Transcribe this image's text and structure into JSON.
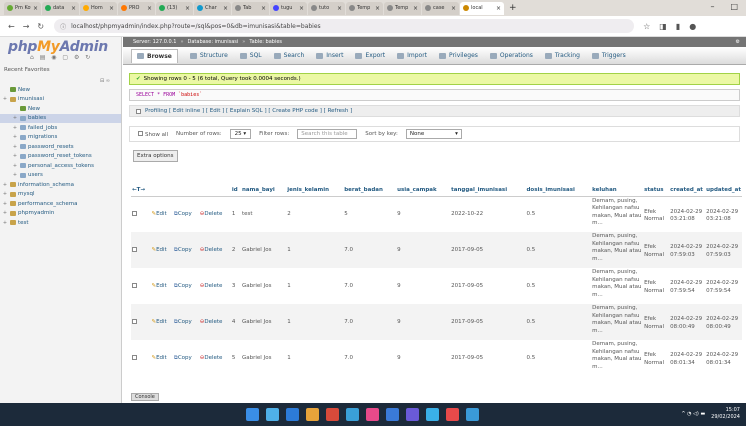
{
  "browser": {
    "tabs": [
      {
        "label": "Pm Kotak",
        "color": "#6a3"
      },
      {
        "label": "data",
        "color": "#2a5"
      },
      {
        "label": "Hom",
        "color": "#fa0"
      },
      {
        "label": "PRO",
        "color": "#f70"
      },
      {
        "label": "(13)",
        "color": "#2a5"
      },
      {
        "label": "Char",
        "color": "#19c"
      },
      {
        "label": "Tab",
        "color": "#888"
      },
      {
        "label": "tugu",
        "color": "#44f"
      },
      {
        "label": "tuto",
        "color": "#888"
      },
      {
        "label": "Temp",
        "color": "#888"
      },
      {
        "label": "Temp",
        "color": "#888"
      },
      {
        "label": "case",
        "color": "#888"
      },
      {
        "label": "local",
        "color": "#c80",
        "active": true
      }
    ],
    "url": "localhost/phpmyadmin/index.php?route=/sql&pos=0&db=imunisasi&table=babies"
  },
  "sidebar": {
    "logo_php": "php",
    "logo_my": "My",
    "logo_admin": "Admin",
    "recent": "Recent   Favorites",
    "tree": [
      {
        "label": "New",
        "level": 0,
        "type": "new"
      },
      {
        "label": "imunisasi",
        "level": 0,
        "type": "db"
      },
      {
        "label": "New",
        "level": 1,
        "type": "new"
      },
      {
        "label": "babies",
        "level": 1,
        "type": "tbl",
        "selected": true
      },
      {
        "label": "failed_jobs",
        "level": 1,
        "type": "tbl"
      },
      {
        "label": "migrations",
        "level": 1,
        "type": "tbl"
      },
      {
        "label": "password_resets",
        "level": 1,
        "type": "tbl"
      },
      {
        "label": "password_reset_tokens",
        "level": 1,
        "type": "tbl"
      },
      {
        "label": "personal_access_tokens",
        "level": 1,
        "type": "tbl"
      },
      {
        "label": "users",
        "level": 1,
        "type": "tbl"
      },
      {
        "label": "information_schema",
        "level": 0,
        "type": "db"
      },
      {
        "label": "mysql",
        "level": 0,
        "type": "db"
      },
      {
        "label": "performance_schema",
        "level": 0,
        "type": "db"
      },
      {
        "label": "phpmyadmin",
        "level": 0,
        "type": "db"
      },
      {
        "label": "test",
        "level": 0,
        "type": "db"
      }
    ]
  },
  "main": {
    "crumb": [
      "Server: 127.0.0.1",
      "Database: imunisasi",
      "Table: babies"
    ],
    "menu": [
      "Browse",
      "Structure",
      "SQL",
      "Search",
      "Insert",
      "Export",
      "Import",
      "Privileges",
      "Operations",
      "Tracking",
      "Triggers"
    ],
    "success": "Showing rows 0 - 5 (6 total, Query took 0.0004 seconds.)",
    "sql_kw": "SELECT * FROM",
    "sql_table": "`babies`",
    "profiling": "Profiling [ Edit inline ] [ Edit ] [ Explain SQL ] [ Create PHP code ] [ Refresh ]",
    "show_all": "Show all",
    "rows_label": "Number of rows:",
    "rows_value": "25",
    "filter_label": "Filter rows:",
    "filter_placeholder": "Search this table",
    "sort_label": "Sort by key:",
    "sort_value": "None",
    "extra_options": "Extra options",
    "console": "Console"
  },
  "table": {
    "headers": [
      "",
      "",
      "",
      "",
      "id",
      "nama_bayi",
      "jenis_kelamin",
      "berat_badan",
      "usia_campak",
      "tanggal_imunisasi",
      "dosis_imunisasi",
      "keluhan",
      "status",
      "created_at",
      "updated_at"
    ],
    "arrows": "←T→",
    "actions": {
      "edit": "Edit",
      "copy": "Copy",
      "delete": "Delete"
    },
    "rows": [
      {
        "id": "1",
        "nama": "test",
        "jk": "2",
        "berat": "5",
        "usia": "9",
        "tgl": "2022-10-22",
        "dosis": "0.5",
        "keluhan": "Demam, pusing, Kehilangan nafsu makan, Mual atau m...",
        "status": "Efek Normal",
        "created": "2024-02-29 03:21:08",
        "updated": "2024-02-29 03:21:08"
      },
      {
        "id": "2",
        "nama": "Gabriel Jos",
        "jk": "1",
        "berat": "7.0",
        "usia": "9",
        "tgl": "2017-09-05",
        "dosis": "0.5",
        "keluhan": "Demam, pusing, Kehilangan nafsu makan, Mual atau m...",
        "status": "Efek Normal",
        "created": "2024-02-29 07:59:03",
        "updated": "2024-02-29 07:59:03"
      },
      {
        "id": "3",
        "nama": "Gabriel Jos",
        "jk": "1",
        "berat": "7.0",
        "usia": "9",
        "tgl": "2017-09-05",
        "dosis": "0.5",
        "keluhan": "Demam, pusing, Kehilangan nafsu makan, Mual atau m...",
        "status": "Efek Normal",
        "created": "2024-02-29 07:59:54",
        "updated": "2024-02-29 07:59:54"
      },
      {
        "id": "4",
        "nama": "Gabriel Jos",
        "jk": "1",
        "berat": "7.0",
        "usia": "9",
        "tgl": "2017-09-05",
        "dosis": "0.5",
        "keluhan": "Demam, pusing, Kehilangan nafsu makan, Mual atau m...",
        "status": "Efek Normal",
        "created": "2024-02-29 08:00:49",
        "updated": "2024-02-29 08:00:49"
      },
      {
        "id": "5",
        "nama": "Gabriel Jos",
        "jk": "1",
        "berat": "7.0",
        "usia": "9",
        "tgl": "2017-09-05",
        "dosis": "0.5",
        "keluhan": "Demam, pusing, Kehilangan nafsu makan, Mual atau m...",
        "status": "Efek Normal",
        "created": "2024-02-29 08:01:34",
        "updated": "2024-02-29 08:01:34"
      }
    ]
  },
  "taskbar": {
    "time": "15:07",
    "date": "29/02/2024",
    "icons": [
      "#3a8ee6",
      "#4fb0e8",
      "#2c7bd8",
      "#e7a33a",
      "#d84a3a",
      "#3aa0d8",
      "#e84a8a",
      "#3a7ad8",
      "#6a5ad8",
      "#3ab0e8",
      "#e84a4a",
      "#3a9ad8"
    ]
  }
}
